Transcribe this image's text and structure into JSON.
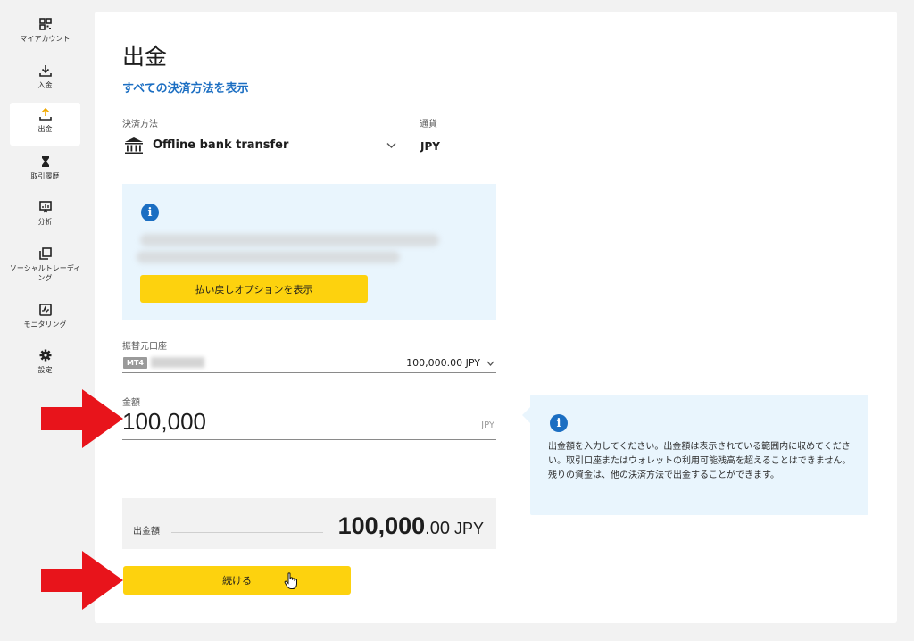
{
  "sidebar": {
    "items": [
      {
        "label": "マイアカウント",
        "icon": "dashboard-icon"
      },
      {
        "label": "入金",
        "icon": "download-icon"
      },
      {
        "label": "出金",
        "icon": "upload-icon",
        "active": true
      },
      {
        "label": "取引履歴",
        "icon": "hourglass-icon"
      },
      {
        "label": "分析",
        "icon": "analytics-icon"
      },
      {
        "label": "ソーシャルトレーディング",
        "icon": "copy-icon"
      },
      {
        "label": "モニタリング",
        "icon": "monitor-icon"
      },
      {
        "label": "設定",
        "icon": "gear-icon"
      }
    ]
  },
  "page": {
    "title": "出金",
    "all_methods_link": "すべての決済方法を表示"
  },
  "payment": {
    "method_label": "決済方法",
    "method_value": "Offline bank transfer",
    "method_icon": "bank-icon",
    "currency_label": "通貨",
    "currency_value": "JPY"
  },
  "info": {
    "refund_button": "払い戻しオプションを表示"
  },
  "account": {
    "label": "振替元口座",
    "badge": "MT4",
    "balance": "100,000.00 JPY"
  },
  "amount": {
    "label": "金額",
    "value": "100,000",
    "unit": "JPY"
  },
  "summary": {
    "label": "出金額",
    "integer": "100,000",
    "decimals": ".00",
    "currency": "JPY"
  },
  "tip": {
    "text": "出金額を入力してください。出金額は表示されている範囲内に収めてください。取引口座またはウォレットの利用可能残高を超えることはできません。残りの資金は、他の決済方法で出金することができます。"
  },
  "continue_button": "続ける",
  "colors": {
    "accent_yellow": "#fdd20e",
    "link_blue": "#1b6ec2",
    "info_bg": "#e9f5fd",
    "annotation_red": "#e8141b"
  }
}
